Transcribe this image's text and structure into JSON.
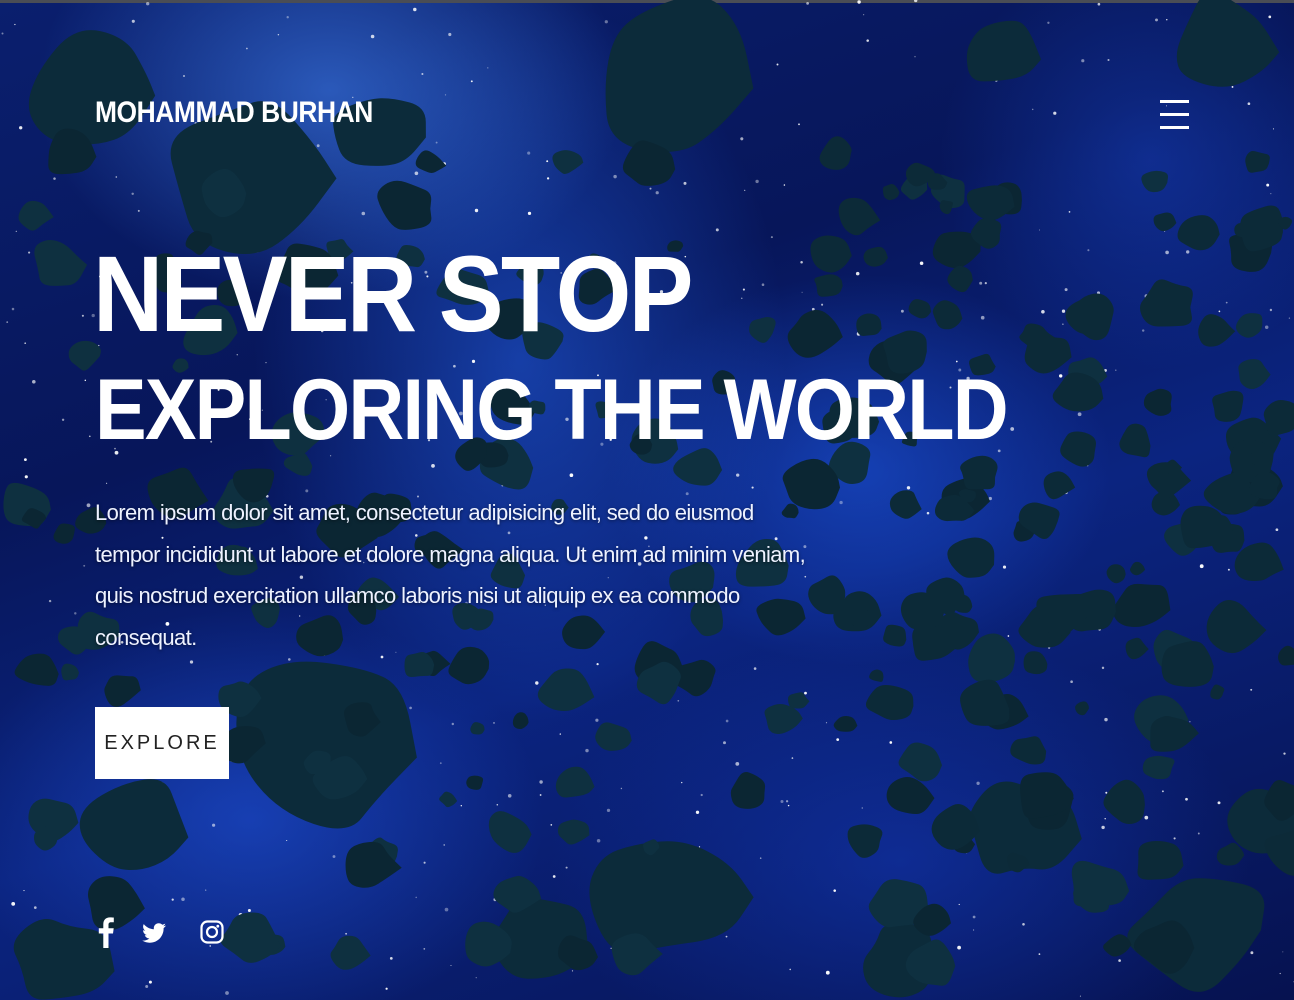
{
  "header": {
    "logo_text": "MOHAMMAD BURHAN",
    "menu_icon": "hamburger-menu-icon"
  },
  "hero": {
    "headline_line1": "NEVER STOP",
    "headline_line2": "EXPLORING THE WORLD",
    "description_lines": [
      "Lorem ipsum dolor sit amet, consectetur adipisicing elit, sed do eiusmod",
      "tempor incididunt ut labore et dolore magna aliqua. Ut enim ad minim veniam,",
      "quis nostrud exercitation ullamco laboris nisi ut aliquip ex ea commodo",
      "consequat."
    ],
    "cta_label": "EXPLORE"
  },
  "social_links": [
    {
      "icon": "facebook-icon"
    },
    {
      "icon": "twitter-icon"
    },
    {
      "icon": "instagram-icon"
    }
  ],
  "colors": {
    "text": "#ffffff",
    "button_bg": "#ffffff",
    "button_text": "#222222",
    "background": "#0a1f6e",
    "asteroid": "#0c2a3a"
  }
}
